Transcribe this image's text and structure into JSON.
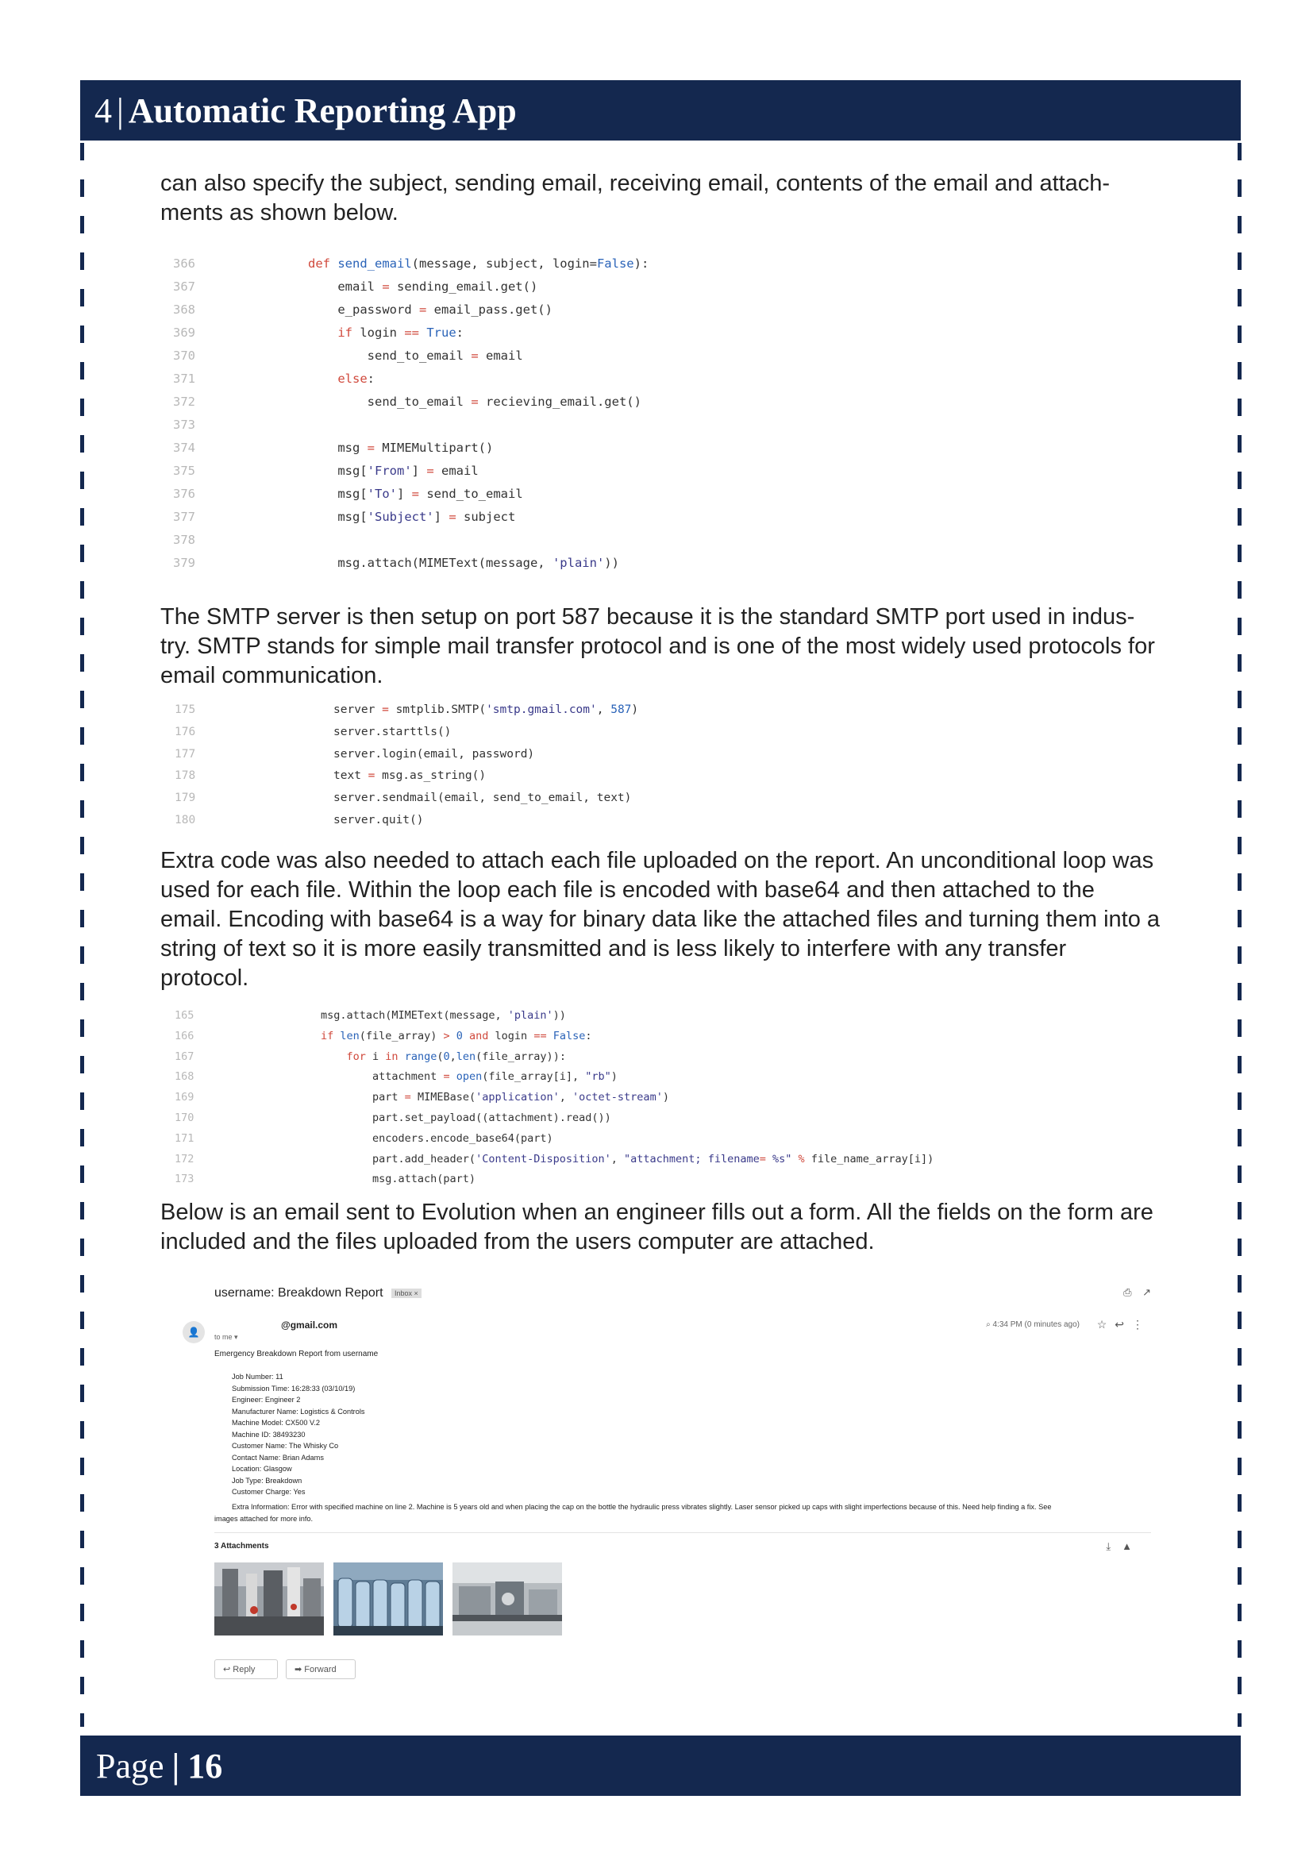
{
  "header": {
    "chapter_number": "4",
    "separator": "|",
    "chapter_title": "Automatic Reporting App"
  },
  "footer": {
    "label": "Page",
    "separator": "|",
    "page_number": "16"
  },
  "paragraphs": {
    "p1": "can also specify the subject, sending email, receiving email, contents of the email and attach-ments as shown below.",
    "p2": "The SMTP server is then setup on port 587 because it is the standard SMTP port used in indus-try. SMTP stands for simple mail transfer protocol and is one of the most widely used protocols for email communication.",
    "p3": "Extra code was also needed to attach each file uploaded on the report. An unconditional loop was used for each file. Within the loop each file is encoded with base64 and then attached to the email. Encoding with base64 is a way for binary data like the attached files and turning them into a string of text so it is more easily transmitted and is less likely to interfere with any transfer protocol.",
    "p4": "Below is an email sent to Evolution when an engineer fills out a form. All the fields on the form are included and the files uploaded from the users computer are attached."
  },
  "code_blocks": [
    {
      "lines": [
        {
          "n": "366",
          "t": "def send_email(message, subject, login=False):"
        },
        {
          "n": "367",
          "t": "    email = sending_email.get()"
        },
        {
          "n": "368",
          "t": "    e_password = email_pass.get()"
        },
        {
          "n": "369",
          "t": "    if login == True:"
        },
        {
          "n": "370",
          "t": "        send_to_email = email"
        },
        {
          "n": "371",
          "t": "    else:"
        },
        {
          "n": "372",
          "t": "        send_to_email = recieving_email.get()"
        },
        {
          "n": "373",
          "t": ""
        },
        {
          "n": "374",
          "t": "    msg = MIMEMultipart()"
        },
        {
          "n": "375",
          "t": "    msg['From'] = email"
        },
        {
          "n": "376",
          "t": "    msg['To'] = send_to_email"
        },
        {
          "n": "377",
          "t": "    msg['Subject'] = subject"
        },
        {
          "n": "378",
          "t": ""
        },
        {
          "n": "379",
          "t": "    msg.attach(MIMEText(message, 'plain'))"
        }
      ]
    },
    {
      "lines": [
        {
          "n": "175",
          "t": "server = smtplib.SMTP('smtp.gmail.com', 587)"
        },
        {
          "n": "176",
          "t": "server.starttls()"
        },
        {
          "n": "177",
          "t": "server.login(email, password)"
        },
        {
          "n": "178",
          "t": "text = msg.as_string()"
        },
        {
          "n": "179",
          "t": "server.sendmail(email, send_to_email, text)"
        },
        {
          "n": "180",
          "t": "server.quit()"
        }
      ]
    },
    {
      "lines": [
        {
          "n": "165",
          "t": "msg.attach(MIMEText(message, 'plain'))"
        },
        {
          "n": "166",
          "t": "if len(file_array) > 0 and login == False:"
        },
        {
          "n": "167",
          "t": "    for i in range(0,len(file_array)):"
        },
        {
          "n": "168",
          "t": "        attachment = open(file_array[i], \"rb\")"
        },
        {
          "n": "169",
          "t": "        part = MIMEBase('application', 'octet-stream')"
        },
        {
          "n": "170",
          "t": "        part.set_payload((attachment).read())"
        },
        {
          "n": "171",
          "t": "        encoders.encode_base64(part)"
        },
        {
          "n": "172",
          "t": "        part.add_header('Content-Disposition', \"attachment; filename= %s\" % file_name_array[i])"
        },
        {
          "n": "173",
          "t": "        msg.attach(part)"
        }
      ]
    }
  ],
  "email": {
    "subject": "username: Breakdown Report",
    "inbox_tag": "Inbox ×",
    "sender": "@gmail.com",
    "to_me": "to me ▾",
    "time": "4:34 PM (0 minutes ago)",
    "heading": "Emergency Breakdown Report from username",
    "fields": [
      "Job Number: 11",
      "Submission Time: 16:28:33 (03/10/19)",
      "Engineer: Engineer 2",
      "Manufacturer Name: Logistics & Controls",
      "Machine Model: CX500 V.2",
      "Machine ID: 38493230",
      "Customer Name: The Whisky Co",
      "Contact Name: Brian Adams",
      "Location: Glasgow",
      "Job Type: Breakdown",
      "Customer Charge: Yes"
    ],
    "extra_line1": "Extra Information: Error with specified machine on line 2. Machine is 5 years old and when placing the cap on the bottle the hydraulic press vibrates slightly. Laser sensor picked up caps with slight imperfections because of this. Need help finding a fix. See",
    "extra_line2": "images attached for more info.",
    "attachments_label": "3 Attachments",
    "reply_label": "Reply",
    "forward_label": "Forward"
  }
}
